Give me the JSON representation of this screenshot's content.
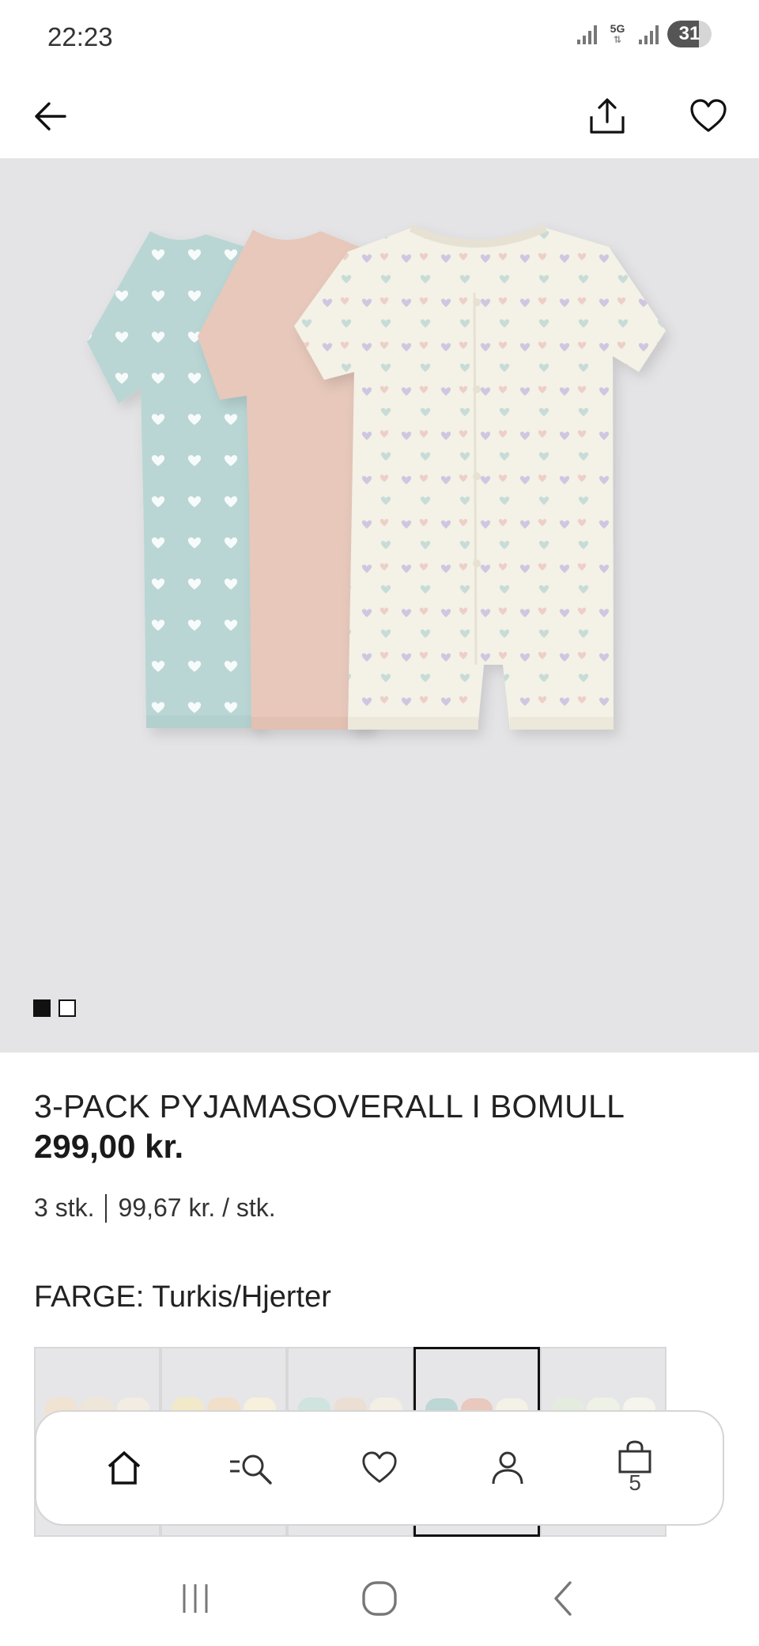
{
  "status_bar": {
    "time": "22:23",
    "network": "5G",
    "battery": "31"
  },
  "header": {
    "back_icon": "arrow-left-icon",
    "share_icon": "share-icon",
    "favorite_icon": "heart-outline-icon"
  },
  "gallery": {
    "image_count": 2,
    "active_index": 0,
    "background": "#e4e4e6",
    "garment_colors": [
      "#b9d6d4",
      "#e7c8bb",
      "#f4f1e6"
    ]
  },
  "product": {
    "title": "3-PACK PYJAMASOVERALL I BOMULL",
    "price": "299,00 kr.",
    "quantity": "3 stk.",
    "unit_price": "99,67 kr. / stk.",
    "color_label": "FARGE:",
    "color_value": "Turkis/Hjerter"
  },
  "swatches": [
    {
      "colors": [
        "#f1e3d2",
        "#efe6da",
        "#f3ece2"
      ],
      "selected": false
    },
    {
      "colors": [
        "#f2e9c8",
        "#f1dfc9",
        "#f6f0dd"
      ],
      "selected": false
    },
    {
      "colors": [
        "#cfe3df",
        "#eadfd2",
        "#f3efe5"
      ],
      "selected": false
    },
    {
      "colors": [
        "#bcd7d5",
        "#e9c9bd",
        "#f4f1e6"
      ],
      "selected": true
    },
    {
      "colors": [
        "#e4ecdf",
        "#eef1e6",
        "#f5f5ee"
      ],
      "selected": false
    }
  ],
  "bottom_nav": {
    "items": [
      {
        "icon": "home-icon"
      },
      {
        "icon": "search-filter-icon"
      },
      {
        "icon": "heart-icon"
      },
      {
        "icon": "account-icon"
      },
      {
        "icon": "shopping-bag-icon"
      }
    ],
    "bag_count": "5"
  },
  "system_nav": {
    "items": [
      "recent-apps-icon",
      "home-circle-icon",
      "back-chevron-icon"
    ]
  }
}
